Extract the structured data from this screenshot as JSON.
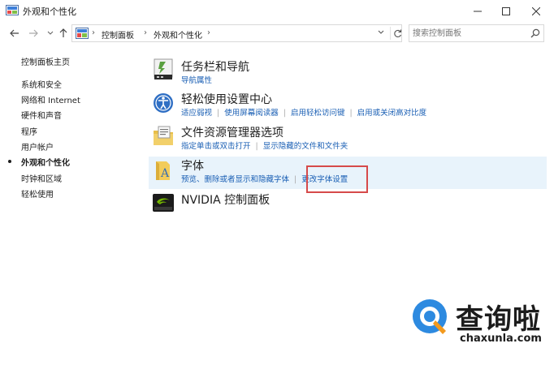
{
  "window": {
    "title": "外观和个性化"
  },
  "breadcrumb": [
    "控制面板",
    "外观和个性化"
  ],
  "search": {
    "placeholder": "搜索控制面板"
  },
  "sidebar": {
    "items": [
      {
        "label": "控制面板主页",
        "active": false
      },
      {
        "label": "系统和安全",
        "active": false
      },
      {
        "label": "网络和 Internet",
        "active": false
      },
      {
        "label": "硬件和声音",
        "active": false
      },
      {
        "label": "程序",
        "active": false
      },
      {
        "label": "用户帐户",
        "active": false
      },
      {
        "label": "外观和个性化",
        "active": true
      },
      {
        "label": "时钟和区域",
        "active": false
      },
      {
        "label": "轻松使用",
        "active": false
      }
    ]
  },
  "categories": [
    {
      "title": "任务栏和导航",
      "links": [
        "导航属性"
      ]
    },
    {
      "title": "轻松使用设置中心",
      "links": [
        "适应弱视",
        "使用屏幕阅读器",
        "启用轻松访问键",
        "启用或关闭高对比度"
      ]
    },
    {
      "title": "文件资源管理器选项",
      "links": [
        "指定单击或双击打开",
        "显示隐藏的文件和文件夹"
      ]
    },
    {
      "title": "字体",
      "links": [
        "预览、删除或者显示和隐藏字体",
        "更改字体设置"
      ]
    },
    {
      "title": "NVIDIA 控制面板",
      "links": []
    }
  ],
  "watermark": {
    "text": "查询啦",
    "url": "chaxunla.com"
  },
  "colors": {
    "link": "#1a5fb4",
    "highlight": "#e8f3fb",
    "annotation": "#d64a4a",
    "watermark_accent": "#2d8ae0",
    "watermark_orange": "#f39a1e"
  }
}
